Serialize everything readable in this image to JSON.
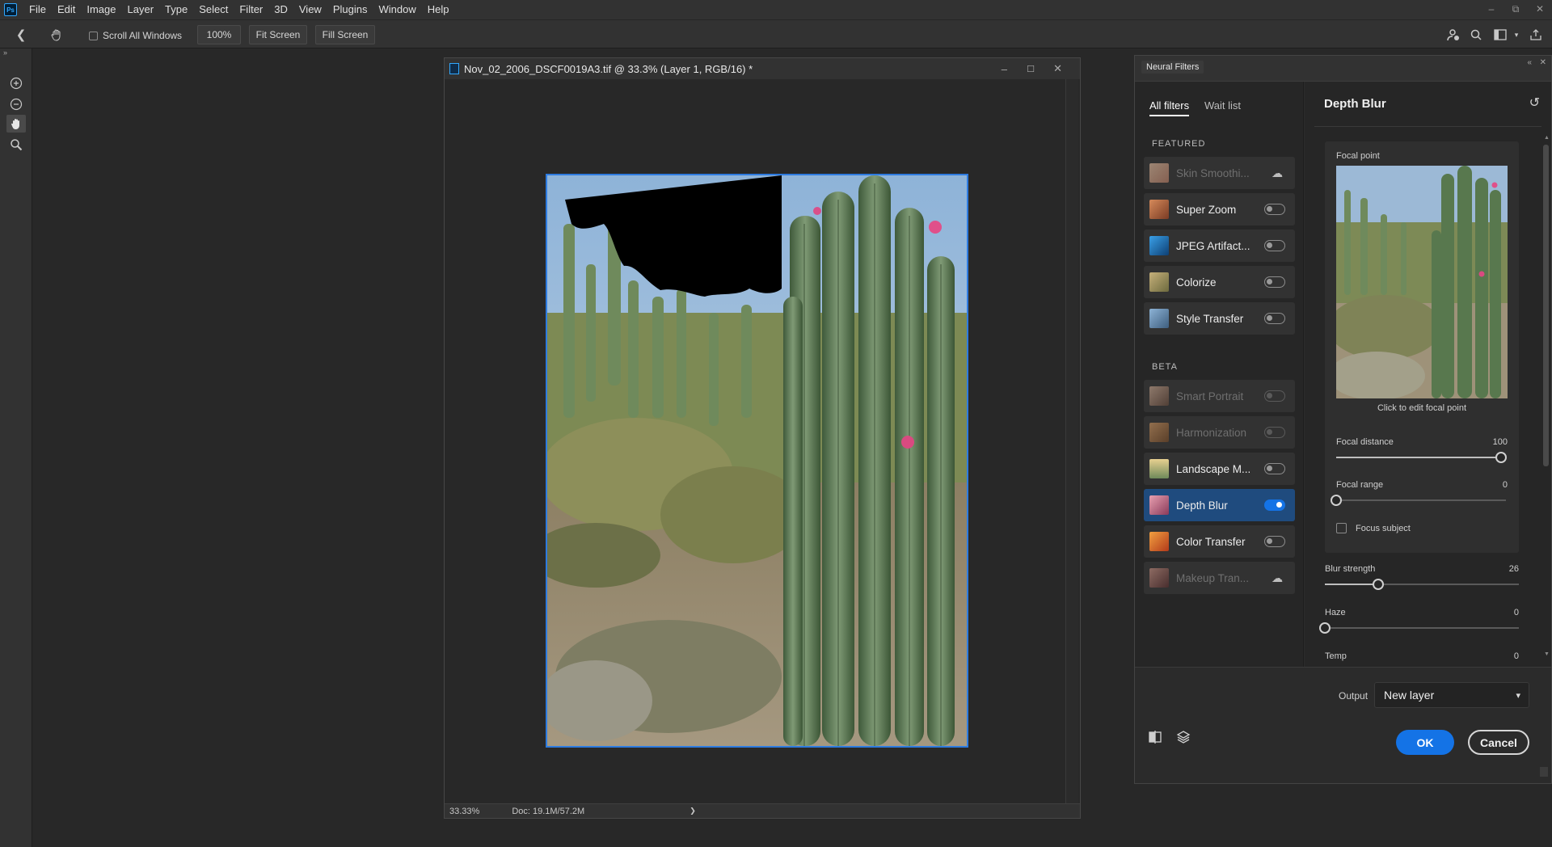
{
  "app": {
    "logo_text": "Ps",
    "menu": [
      "File",
      "Edit",
      "Image",
      "Layer",
      "Type",
      "Select",
      "Filter",
      "3D",
      "View",
      "Plugins",
      "Window",
      "Help"
    ],
    "window_controls": [
      "–",
      "⧉",
      "✕"
    ]
  },
  "options_bar": {
    "scroll_all_windows": "Scroll All Windows",
    "zoom_value": "100%",
    "fit_screen": "Fit Screen",
    "fill_screen": "Fill Screen"
  },
  "document": {
    "title": "Nov_02_2006_DSCF0019A3.tif @ 33.3% (Layer 1, RGB/16) *",
    "zoom": "33.33%",
    "doc_size": "Doc: 19.1M/57.2M",
    "status_arrow": "❯"
  },
  "neural_filters": {
    "panel_title": "Neural Filters",
    "tabs": {
      "all": "All filters",
      "wait": "Wait list"
    },
    "featured_label": "FEATURED",
    "beta_label": "BETA",
    "featured": [
      {
        "name": "Skin Smoothi...",
        "state": "cloud"
      },
      {
        "name": "Super Zoom",
        "state": "off"
      },
      {
        "name": "JPEG Artifact...",
        "state": "off"
      },
      {
        "name": "Colorize",
        "state": "off"
      },
      {
        "name": "Style Transfer",
        "state": "off"
      }
    ],
    "beta": [
      {
        "name": "Smart Portrait",
        "state": "disabled"
      },
      {
        "name": "Harmonization",
        "state": "disabled"
      },
      {
        "name": "Landscape M...",
        "state": "off"
      },
      {
        "name": "Depth Blur",
        "state": "on"
      },
      {
        "name": "Color Transfer",
        "state": "off"
      },
      {
        "name": "Makeup Tran...",
        "state": "cloud"
      }
    ],
    "settings": {
      "title": "Depth Blur",
      "focal_point_label": "Focal point",
      "focal_caption": "Click to edit focal point",
      "focal_distance": {
        "label": "Focal distance",
        "value": 100
      },
      "focal_range": {
        "label": "Focal range",
        "value": 0
      },
      "focus_subject": "Focus subject",
      "blur_strength": {
        "label": "Blur strength",
        "value": 26
      },
      "haze": {
        "label": "Haze",
        "value": 0
      },
      "temp": {
        "label": "Temp",
        "value": 0
      }
    },
    "output_label": "Output",
    "output_value": "New layer",
    "ok": "OK",
    "cancel": "Cancel"
  },
  "colors": {
    "accent": "#1473e6",
    "selection_border": "#2d7be0",
    "selected_row": "#1f4b7e"
  }
}
